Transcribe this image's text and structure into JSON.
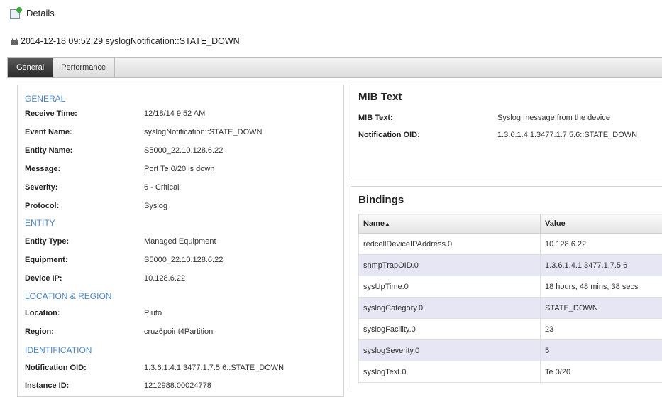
{
  "header": {
    "title": "Details"
  },
  "event": {
    "title": "2014-12-18 09:52:29 syslogNotification::STATE_DOWN"
  },
  "tabs": [
    {
      "label": "General",
      "active": true
    },
    {
      "label": "Performance",
      "active": false
    }
  ],
  "general": {
    "section_general": "GENERAL",
    "receive_time": {
      "label": "Receive Time:",
      "value": "12/18/14 9:52 AM"
    },
    "event_name": {
      "label": "Event Name:",
      "value": "syslogNotification::STATE_DOWN"
    },
    "entity_name": {
      "label": "Entity Name:",
      "value": "S5000_22.10.128.6.22"
    },
    "message": {
      "label": "Message:",
      "value": "Port Te 0/20 is down"
    },
    "severity": {
      "label": "Severity:",
      "value": "6 - Critical"
    },
    "protocol": {
      "label": "Protocol:",
      "value": "Syslog"
    },
    "section_entity": "ENTITY",
    "entity_type": {
      "label": "Entity Type:",
      "value": "Managed Equipment"
    },
    "equipment": {
      "label": "Equipment:",
      "value": "S5000_22.10.128.6.22"
    },
    "device_ip": {
      "label": "Device IP:",
      "value": "10.128.6.22"
    },
    "section_location": "LOCATION & REGION",
    "location": {
      "label": "Location:",
      "value": "Pluto"
    },
    "region": {
      "label": "Region:",
      "value": "cruz6point4Partition"
    },
    "section_identification": "IDENTIFICATION",
    "notification_oid": {
      "label": "Notification OID:",
      "value": "1.3.6.1.4.1.3477.1.7.5.6::STATE_DOWN"
    },
    "instance_id": {
      "label": "Instance ID:",
      "value": "1212988:00024778"
    }
  },
  "mib": {
    "heading": "MIB Text",
    "mib_text": {
      "label": "MIB Text:",
      "value": "Syslog message from the device"
    },
    "notification_oid": {
      "label": "Notification OID:",
      "value": "1.3.6.1.4.1.3477.1.7.5.6::STATE_DOWN"
    }
  },
  "bindings": {
    "heading": "Bindings",
    "col_name": "Name",
    "col_value": "Value",
    "rows": [
      {
        "name": "redcellDeviceIPAddress.0",
        "value": "10.128.6.22"
      },
      {
        "name": "snmpTrapOID.0",
        "value": "1.3.6.1.4.1.3477.1.7.5.6"
      },
      {
        "name": "sysUpTime.0",
        "value": "18 hours, 48 mins, 38 secs"
      },
      {
        "name": "syslogCategory.0",
        "value": "STATE_DOWN"
      },
      {
        "name": "syslogFacility.0",
        "value": "23"
      },
      {
        "name": "syslogSeverity.0",
        "value": "5"
      },
      {
        "name": "syslogText.0",
        "value": "Te 0/20"
      }
    ]
  },
  "colors": {
    "section": "#4a86c6",
    "alt_row": "#e6e6f5",
    "tab_active": "#3a3a3a"
  },
  "icons": {
    "header": "details-icon",
    "event": "lock-icon",
    "sort": "sort-ascending-icon"
  }
}
